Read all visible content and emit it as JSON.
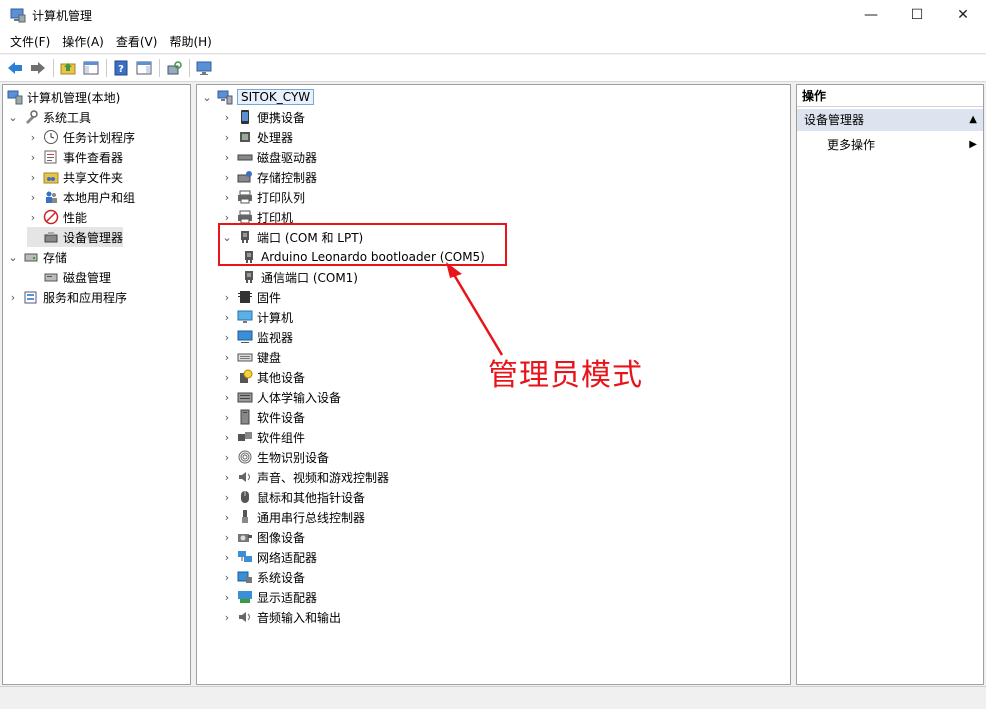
{
  "window": {
    "title": "计算机管理",
    "min_label": "—",
    "max_label": "☐",
    "close_label": "✕"
  },
  "menu": [
    {
      "label": "文件(F)"
    },
    {
      "label": "操作(A)"
    },
    {
      "label": "查看(V)"
    },
    {
      "label": "帮助(H)"
    }
  ],
  "left_tree": [
    {
      "label": "计算机管理(本地)",
      "icon": "computer-management-icon",
      "expander": ""
    },
    {
      "label": "系统工具",
      "icon": "tools-icon",
      "expander": "expanded"
    },
    {
      "label": "任务计划程序",
      "icon": "clock-icon",
      "expander": "collapsed"
    },
    {
      "label": "事件查看器",
      "icon": "event-viewer-icon",
      "expander": "collapsed"
    },
    {
      "label": "共享文件夹",
      "icon": "shared-folder-icon",
      "expander": "collapsed"
    },
    {
      "label": "本地用户和组",
      "icon": "users-icon",
      "expander": "collapsed"
    },
    {
      "label": "性能",
      "icon": "performance-icon",
      "expander": "collapsed"
    },
    {
      "label": "设备管理器",
      "icon": "device-manager-icon",
      "expander": ""
    },
    {
      "label": "存储",
      "icon": "storage-icon",
      "expander": "expanded"
    },
    {
      "label": "磁盘管理",
      "icon": "disk-icon",
      "expander": ""
    },
    {
      "label": "服务和应用程序",
      "icon": "services-icon",
      "expander": "collapsed"
    }
  ],
  "device_tree": {
    "root": "SITOK_CYW",
    "items": [
      {
        "label": "便携设备",
        "icon": "portable-device-icon",
        "expander": "collapsed"
      },
      {
        "label": "处理器",
        "icon": "processor-icon",
        "expander": "collapsed"
      },
      {
        "label": "磁盘驱动器",
        "icon": "disk-drive-icon",
        "expander": "collapsed"
      },
      {
        "label": "存储控制器",
        "icon": "storage-controller-icon",
        "expander": "collapsed"
      },
      {
        "label": "打印队列",
        "icon": "print-queue-icon",
        "expander": "collapsed"
      },
      {
        "label": "打印机",
        "icon": "printer-icon",
        "expander": "collapsed"
      },
      {
        "label": "端口 (COM 和 LPT)",
        "icon": "port-icon",
        "expander": "expanded"
      },
      {
        "label": "Arduino Leonardo bootloader (COM5)",
        "icon": "port-icon",
        "expander": "child"
      },
      {
        "label": "通信端口 (COM1)",
        "icon": "port-icon",
        "expander": "child"
      },
      {
        "label": "固件",
        "icon": "firmware-icon",
        "expander": "collapsed"
      },
      {
        "label": "计算机",
        "icon": "computer-icon",
        "expander": "collapsed"
      },
      {
        "label": "监视器",
        "icon": "monitor-icon",
        "expander": "collapsed"
      },
      {
        "label": "键盘",
        "icon": "keyboard-icon",
        "expander": "collapsed"
      },
      {
        "label": "其他设备",
        "icon": "other-device-icon",
        "expander": "collapsed"
      },
      {
        "label": "人体学输入设备",
        "icon": "hid-icon",
        "expander": "collapsed"
      },
      {
        "label": "软件设备",
        "icon": "software-device-icon",
        "expander": "collapsed"
      },
      {
        "label": "软件组件",
        "icon": "software-component-icon",
        "expander": "collapsed"
      },
      {
        "label": "生物识别设备",
        "icon": "fingerprint-icon",
        "expander": "collapsed"
      },
      {
        "label": "声音、视频和游戏控制器",
        "icon": "speaker-icon",
        "expander": "collapsed"
      },
      {
        "label": "鼠标和其他指针设备",
        "icon": "mouse-icon",
        "expander": "collapsed"
      },
      {
        "label": "通用串行总线控制器",
        "icon": "usb-icon",
        "expander": "collapsed"
      },
      {
        "label": "图像设备",
        "icon": "camera-icon",
        "expander": "collapsed"
      },
      {
        "label": "网络适配器",
        "icon": "network-icon",
        "expander": "collapsed"
      },
      {
        "label": "系统设备",
        "icon": "system-device-icon",
        "expander": "collapsed"
      },
      {
        "label": "显示适配器",
        "icon": "display-adapter-icon",
        "expander": "collapsed"
      },
      {
        "label": "音频输入和输出",
        "icon": "audio-io-icon",
        "expander": "collapsed"
      }
    ]
  },
  "actions": {
    "header": "操作",
    "section": "设备管理器",
    "item": "更多操作"
  },
  "annotation": "管理员模式",
  "colors": {
    "annotation": "#e8141a",
    "section_bg": "#dde4ef",
    "selection_bg": "#e5e5e5"
  }
}
